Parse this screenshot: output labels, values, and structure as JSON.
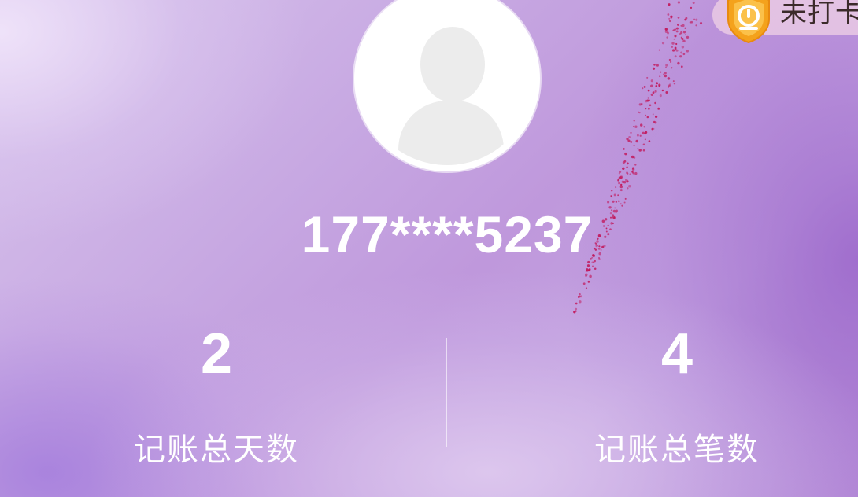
{
  "profile": {
    "avatar_icon": "default-user-avatar-icon",
    "username": "177****5237"
  },
  "checkin": {
    "icon": "shield-clock-badge-icon",
    "label": "未打卡"
  },
  "stats": [
    {
      "value": "2",
      "label": "记账总天数"
    },
    {
      "value": "4",
      "label": "记账总笔数"
    }
  ],
  "colors": {
    "background_primary": "#c7a8e2",
    "text": "#ffffff",
    "badge_orange": "#f4a21c",
    "sparkle": "#c2185b"
  }
}
